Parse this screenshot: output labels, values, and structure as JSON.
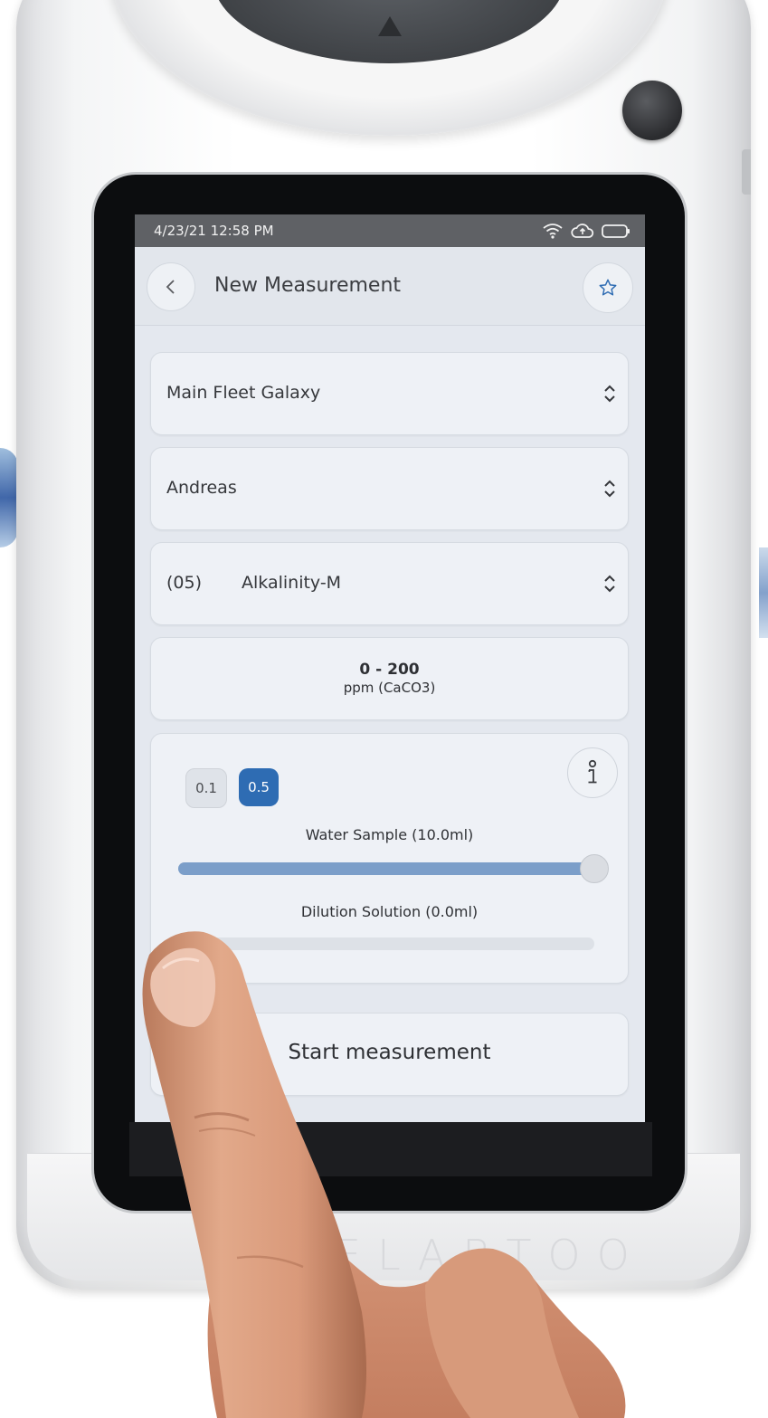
{
  "status_bar": {
    "datetime": "4/23/21 12:58 PM",
    "icons": [
      "wifi-icon",
      "cloud-upload-icon",
      "battery-icon"
    ]
  },
  "header": {
    "title": "New Measurement",
    "back_icon": "chevron-left-icon",
    "favorite_icon": "star-icon"
  },
  "selectors": {
    "fleet": "Main Fleet Galaxy",
    "user": "Andreas",
    "method_code": "(05)",
    "method_name": "Alkalinity-M"
  },
  "range": {
    "value": "0 - 200",
    "unit": "ppm (CaCO3)"
  },
  "dilution": {
    "steps": [
      "0.1",
      "0.5"
    ],
    "selected_step": "0.5",
    "water_sample_label": "Water Sample (10.0ml)",
    "water_sample_fraction": 1.0,
    "dilution_label": "Dilution Solution (0.0ml)",
    "dilution_fraction": 0.0,
    "info_icon": "info-icon"
  },
  "actions": {
    "start_label": "Start measurement"
  },
  "device": {
    "brand": "ELABTOO"
  },
  "colors": {
    "accent": "#2e6cb3",
    "slider_fill": "#7b9ec9",
    "status_bar": "#5f6165",
    "screen_bg": "#e4e8ef"
  }
}
